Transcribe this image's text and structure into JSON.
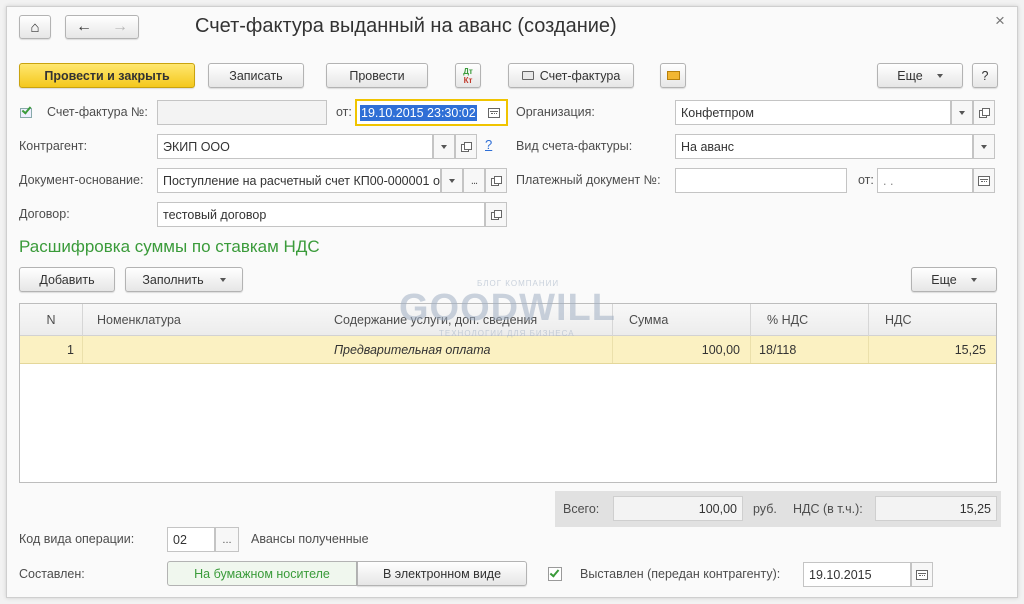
{
  "window": {
    "title": "Счет-фактура выданный на аванс (создание)",
    "close_glyph": "×"
  },
  "nav": {
    "home_glyph": "⌂",
    "back_glyph": "←",
    "forward_glyph": "→"
  },
  "toolbar": {
    "post_and_close": "Провести и закрыть",
    "save": "Записать",
    "post": "Провести",
    "invoice_print": "Счет-фактура",
    "more": "Еще",
    "help": "?",
    "dt_kt_top": "Дт",
    "dt_kt_bottom": "Кт"
  },
  "form": {
    "invoice_no_label": "Счет-фактура №:",
    "invoice_no_value": "",
    "from_label": "от:",
    "date_value": "19.10.2015 23:30:02",
    "organization_label": "Организация:",
    "organization_value": "Конфетпром",
    "counterparty_label": "Контрагент:",
    "counterparty_value": "ЭКИП ООО",
    "counterparty_help": "?",
    "invoice_kind_label": "Вид счета-фактуры:",
    "invoice_kind_value": "На аванс",
    "base_doc_label": "Документ-основание:",
    "base_doc_value": "Поступление на расчетный счет КП00-000001 о",
    "payment_doc_label": "Платежный документ №:",
    "payment_doc_value": "",
    "payment_from_label": "от:",
    "payment_date_value": " .  .",
    "contract_label": "Договор:",
    "contract_value": "тестовый договор"
  },
  "section": {
    "title": "Расшифровка суммы по ставкам НДС",
    "add": "Добавить",
    "fill": "Заполнить",
    "more": "Еще"
  },
  "table": {
    "columns": [
      "N",
      "Номенклатура",
      "Содержание услуги, доп. сведения",
      "Сумма",
      "% НДС",
      "НДС"
    ],
    "rows": [
      {
        "n": "1",
        "item": "",
        "content": "Предварительная оплата",
        "sum": "100,00",
        "vat_rate": "18/118",
        "vat": "15,25"
      }
    ]
  },
  "totals": {
    "total_label": "Всего:",
    "total_value": "100,00",
    "currency": "руб.",
    "vat_label": "НДС (в т.ч.):",
    "vat_value": "15,25"
  },
  "bottom": {
    "op_code_label": "Код вида операции:",
    "op_code_value": "02",
    "op_code_button": "...",
    "op_code_desc": "Авансы полученные",
    "compiled_label": "Составлен:",
    "paper": "На бумажном носителе",
    "electronic": "В электронном виде",
    "issued_label": "Выставлен (передан контрагенту):",
    "issued_date": "19.10.2015",
    "issued_checked": true
  },
  "watermark": {
    "top": "БЛОГ КОМПАНИИ",
    "brand": "GOODWILL",
    "bottom": "ТЕХНОЛОГИИ ДЛЯ БИЗНЕСА"
  },
  "colors": {
    "accent_green": "#3a9b3a",
    "primary_yellow": "#f4c81c",
    "row_highlight": "#fbf1c2",
    "date_focus": "#f0c400",
    "selection_blue": "#2f6fd6"
  }
}
